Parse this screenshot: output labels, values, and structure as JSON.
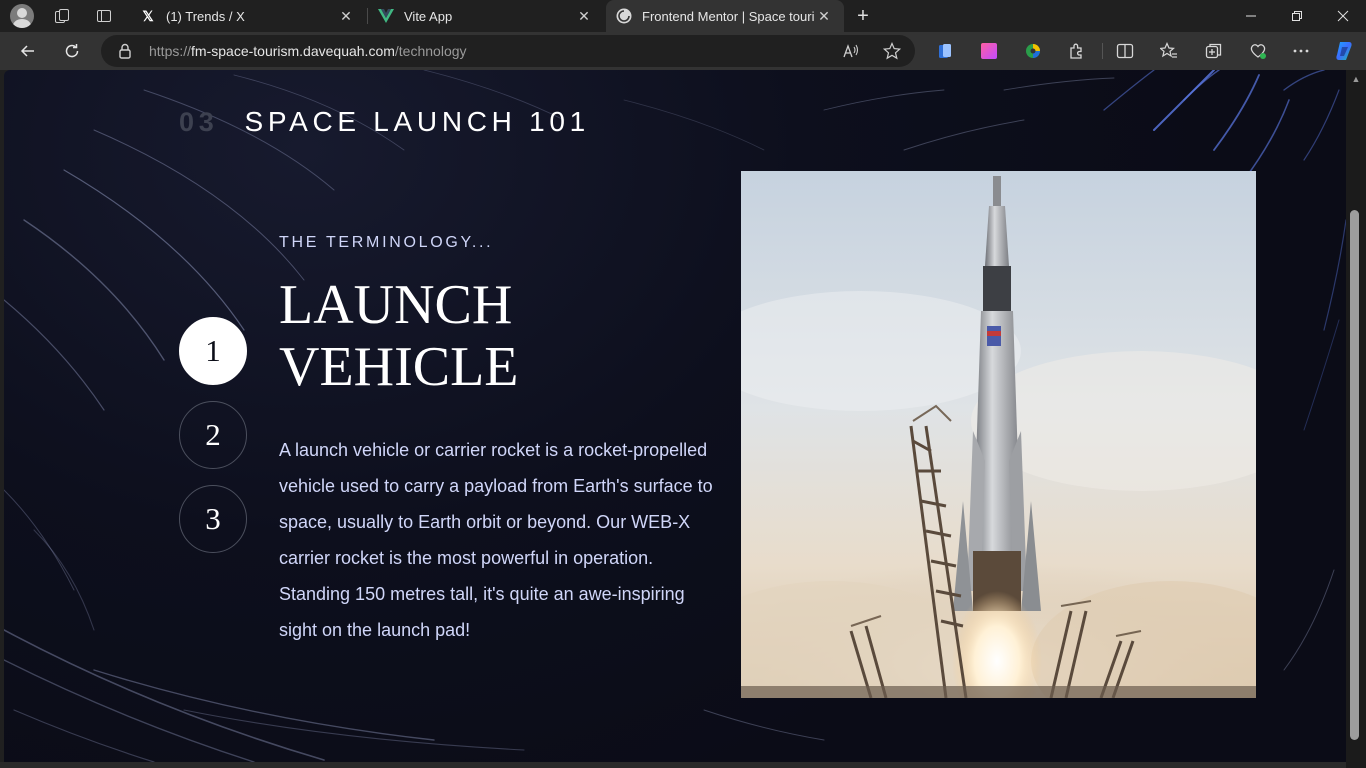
{
  "browser": {
    "tabs": [
      {
        "title": "(1) Trends / X",
        "favicon": "x-logo-icon"
      },
      {
        "title": "Vite App",
        "favicon": "vue-logo-icon"
      },
      {
        "title": "Frontend Mentor | Space tourism",
        "favicon": "frontend-mentor-icon",
        "active": true
      }
    ],
    "url_scheme": "https://",
    "url_host": "fm-space-tourism.davequah.com",
    "url_path": "/technology"
  },
  "page": {
    "heading_number": "03",
    "heading_text": "SPACE LAUNCH 101",
    "steps": [
      "1",
      "2",
      "3"
    ],
    "active_step": "1",
    "subtitle": "THE TERMINOLOGY...",
    "title_line1": "LAUNCH",
    "title_line2": "VEHICLE",
    "description": "A launch vehicle or carrier rocket is a rocket-propelled vehicle used to carry a payload from Earth's surface to space, usually to Earth orbit or beyond. Our WEB-X carrier rocket is the most powerful in operation. Standing 150 metres tall, it's quite an awe-inspiring sight on the launch pad!"
  },
  "colors": {
    "background": "#0b0d17",
    "accent_text": "#d0d6f9",
    "heading_number": "#3d4150"
  }
}
